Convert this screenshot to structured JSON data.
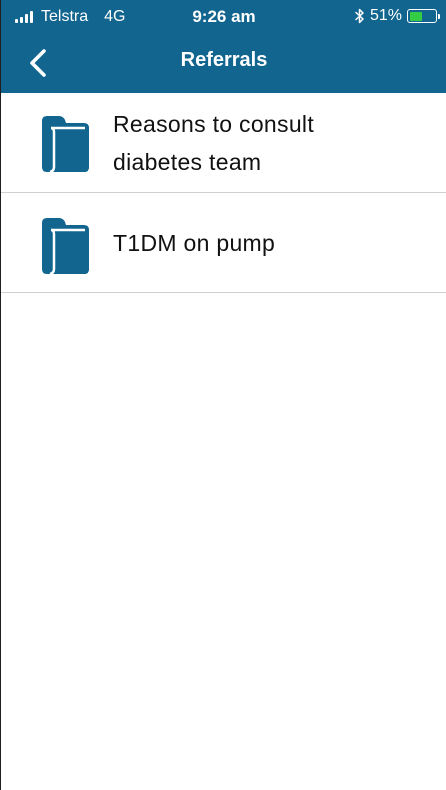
{
  "status_bar": {
    "carrier": "Telstra",
    "network": "4G",
    "time": "9:26 am",
    "battery_percent": "51%",
    "battery_level": 0.51,
    "battery_color": "#33cc44"
  },
  "header": {
    "title": "Referrals",
    "background_color": "#12658f",
    "back_icon": "chevron-left-icon"
  },
  "list": {
    "items": [
      {
        "label_line1": "Reasons to consult",
        "label_line2": "diabetes team",
        "icon": "folder-icon"
      },
      {
        "label_line1": "T1DM on pump",
        "icon": "folder-icon"
      }
    ]
  }
}
